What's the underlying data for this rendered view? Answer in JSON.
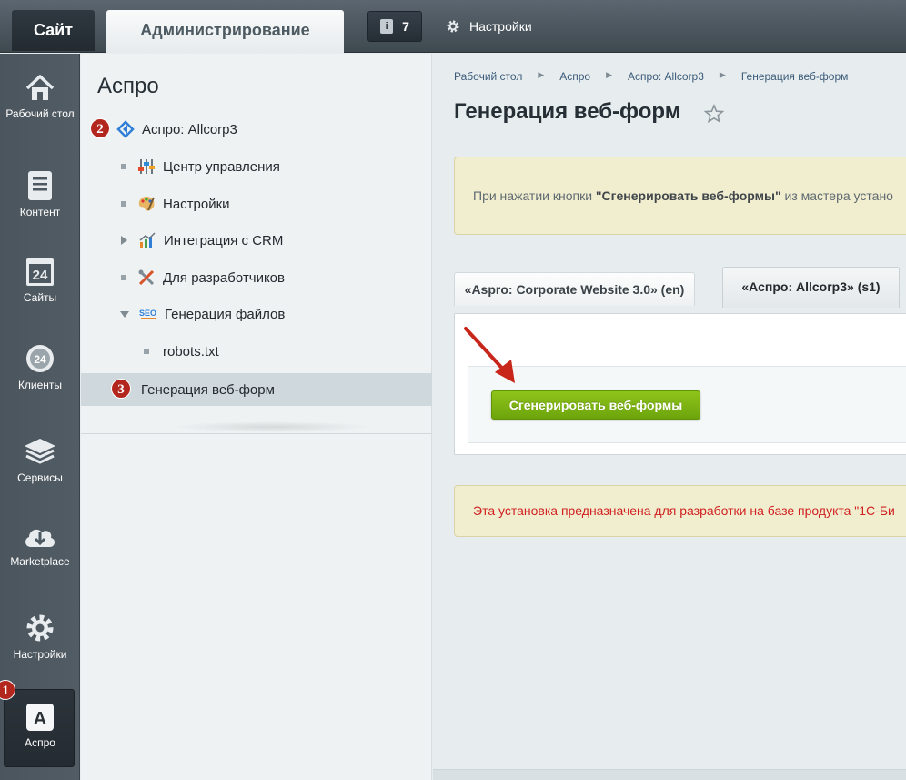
{
  "topbar": {
    "site_tab": "Сайт",
    "admin_tab": "Администрирование",
    "notifications_count": "7",
    "settings_label": "Настройки"
  },
  "leftbar": {
    "items": [
      {
        "label": "Рабочий стол",
        "icon": "home-icon"
      },
      {
        "label": "Контент",
        "icon": "document-icon"
      },
      {
        "label": "Сайты",
        "icon": "calendar-24-icon"
      },
      {
        "label": "Клиенты",
        "icon": "clients-24-icon"
      },
      {
        "label": "Сервисы",
        "icon": "layers-icon"
      },
      {
        "label": "Marketplace",
        "icon": "cloud-download-icon"
      },
      {
        "label": "Настройки",
        "icon": "gear-icon"
      },
      {
        "label": "Аспро",
        "icon": "aspro-icon"
      }
    ],
    "active_item": "Аспро"
  },
  "badges": [
    "1",
    "2",
    "3"
  ],
  "menu": {
    "title": "Аспро",
    "root": "Аспро: Allcorp3",
    "items": [
      {
        "label": "Центр управления",
        "icon": "control-center-icon"
      },
      {
        "label": "Настройки",
        "icon": "palette-icon"
      },
      {
        "label": "Интеграция с CRM",
        "icon": "chart-icon"
      },
      {
        "label": "Для разработчиков",
        "icon": "tools-icon"
      },
      {
        "label": "Генерация файлов",
        "icon": "seo-icon"
      },
      {
        "label": "robots.txt",
        "icon": ""
      }
    ],
    "selected": "Генерация веб-форм"
  },
  "breadcrumbs": [
    "Рабочий стол",
    "Аспро",
    "Аспро: Allcorp3",
    "Генерация веб-форм"
  ],
  "page": {
    "title": "Генерация веб-форм",
    "info_prefix": "При нажатии кнопки ",
    "info_bold": "\"Сгенерировать веб-формы\"",
    "info_suffix": " из мастера устано",
    "tabs": [
      "«Aspro: Corporate Website 3.0» (en)",
      "«Аспро: Allcorp3» (s1)"
    ],
    "active_tab": "«Аспро: Allcorp3» (s1)",
    "generate_button": "Сгенерировать веб-формы",
    "warning": "Эта установка предназначена для разработки на базе продукта \"1С-Би"
  },
  "colors": {
    "accent_green": "#7ab313",
    "badge_red": "#b3261e",
    "warning_text": "#d02020"
  }
}
